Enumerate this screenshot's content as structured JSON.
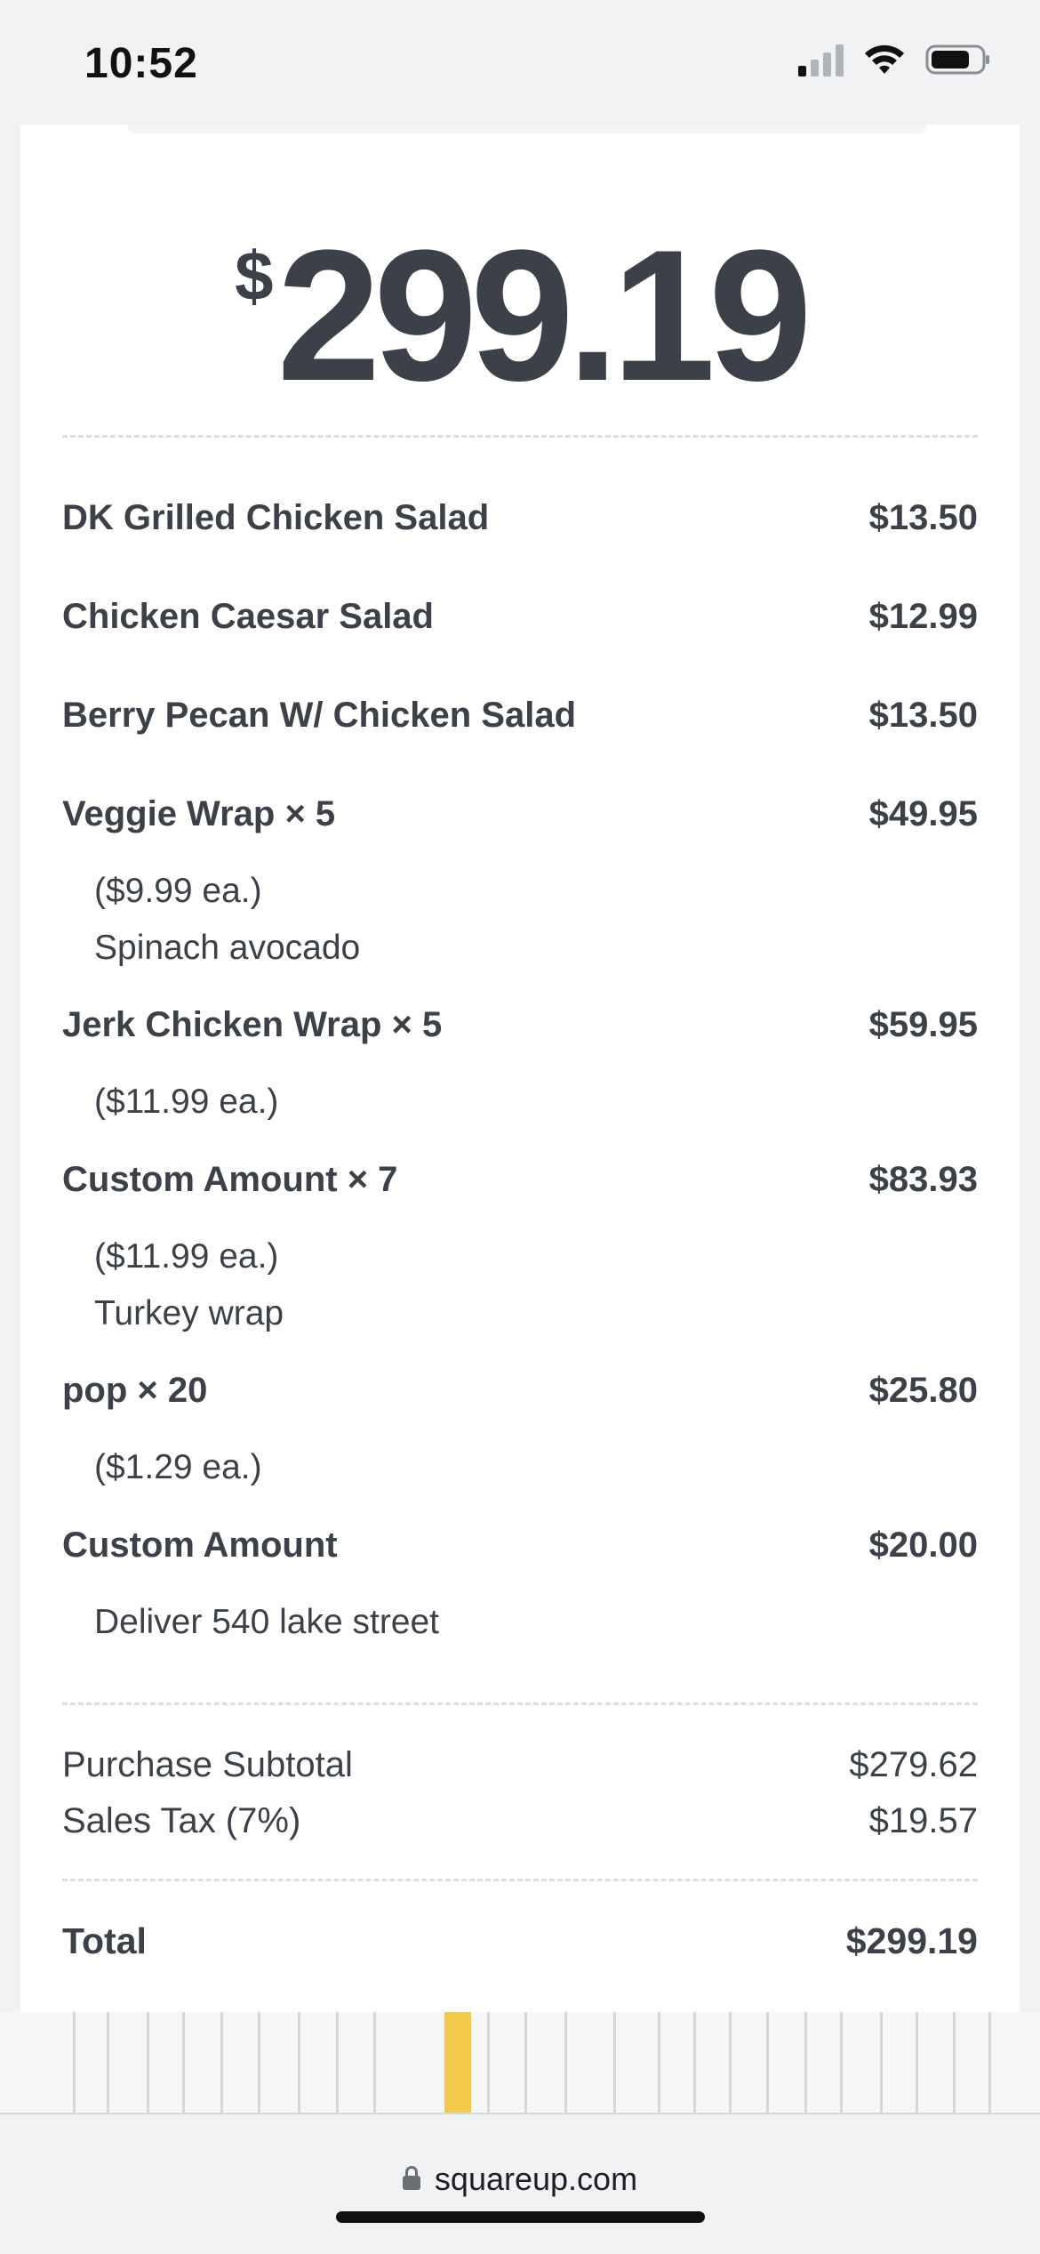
{
  "status_bar": {
    "time": "10:52"
  },
  "receipt": {
    "currency_symbol": "$",
    "amount": "299.19",
    "items": [
      {
        "name": "DK Grilled Chicken Salad",
        "price": "$13.50",
        "details": []
      },
      {
        "name": "Chicken Caesar Salad",
        "price": "$12.99",
        "details": []
      },
      {
        "name": "Berry Pecan W/ Chicken Salad",
        "price": "$13.50",
        "details": []
      },
      {
        "name": "Veggie Wrap × 5",
        "price": "$49.95",
        "details": [
          "($9.99 ea.)",
          "Spinach avocado"
        ]
      },
      {
        "name": "Jerk Chicken Wrap × 5",
        "price": "$59.95",
        "details": [
          "($11.99 ea.)"
        ]
      },
      {
        "name": "Custom Amount × 7",
        "price": "$83.93",
        "details": [
          "($11.99 ea.)",
          "Turkey wrap"
        ]
      },
      {
        "name": "pop × 20",
        "price": "$25.80",
        "details": [
          "($1.29 ea.)"
        ]
      },
      {
        "name": "Custom Amount",
        "price": "$20.00",
        "details": [
          "Deliver 540 lake street"
        ]
      }
    ],
    "subtotal_label": "Purchase Subtotal",
    "subtotal_value": "$279.62",
    "tax_label": "Sales Tax (7%)",
    "tax_value": "$19.57",
    "total_label": "Total",
    "total_value": "$299.19"
  },
  "browser": {
    "url": "squareup.com"
  }
}
